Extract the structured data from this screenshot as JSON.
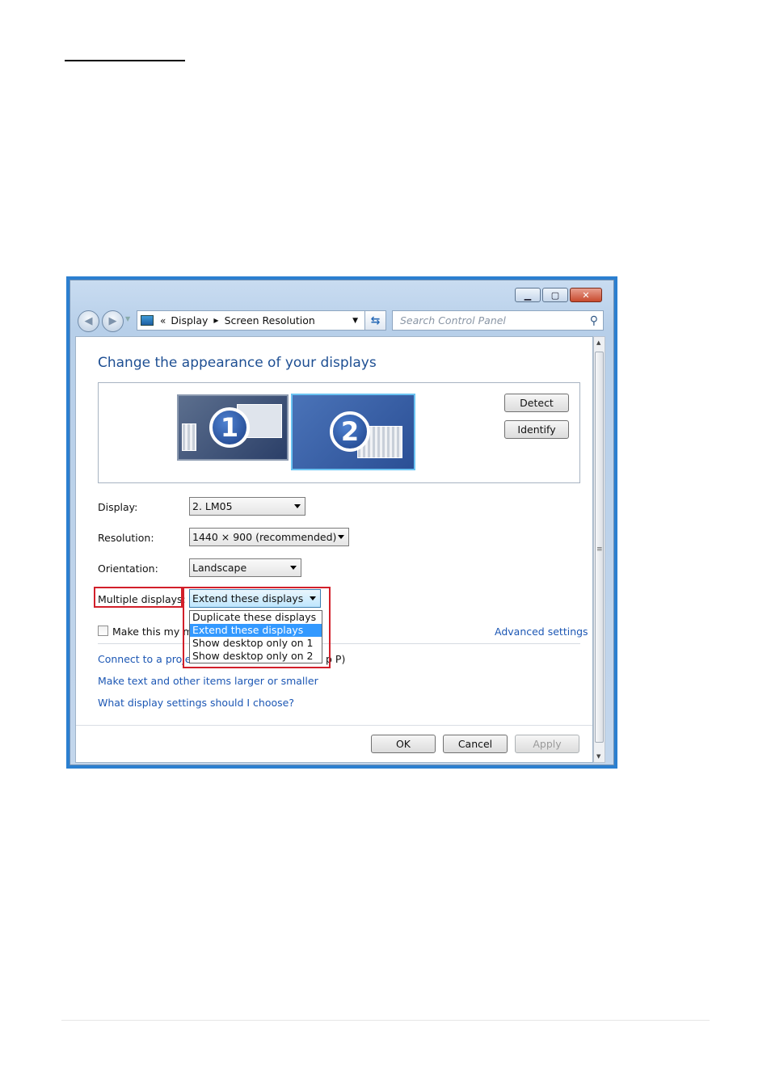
{
  "address_bar": {
    "chevrons": "«",
    "crumb_1": "Display",
    "crumb_2": "Screen Resolution"
  },
  "search": {
    "placeholder": "Search Control Panel"
  },
  "heading": "Change the appearance of your displays",
  "monitors": [
    {
      "number": "1"
    },
    {
      "number": "2"
    }
  ],
  "buttons": {
    "detect": "Detect",
    "identify": "Identify",
    "ok": "OK",
    "cancel": "Cancel",
    "apply": "Apply"
  },
  "fields": {
    "display_label": "Display:",
    "display_value": "2. LM05",
    "resolution_label": "Resolution:",
    "resolution_value": "1440 × 900 (recommended)",
    "orientation_label": "Orientation:",
    "orientation_value": "Landscape",
    "multiple_label": "Multiple displays:",
    "multiple_value": "Extend these displays"
  },
  "multiple_options": [
    "Duplicate these displays",
    "Extend these displays",
    "Show desktop only on 1",
    "Show desktop only on 2"
  ],
  "selected_option_index": 1,
  "checkbox": {
    "label_visible": "Make this my ma",
    "checked": false
  },
  "links": {
    "advanced": "Advanced settings",
    "connect_prefix": "Connect to a proje",
    "connect_suffix": "p P)",
    "text_size": "Make text and other items larger or smaller",
    "which_settings": "What display settings should I choose?"
  },
  "colors": {
    "link": "#1c57b4",
    "heading": "#1e4f93",
    "highlight_box": "#d21f2a",
    "selection": "#3399ff",
    "window_border": "#2b7fd0"
  },
  "icons": {
    "back": "back-arrow-icon",
    "forward": "forward-arrow-icon",
    "control_panel": "control-panel-icon",
    "refresh": "refresh-icon",
    "search": "magnifier-icon",
    "minimize": "minimize-icon",
    "maximize": "maximize-icon",
    "close": "close-icon"
  }
}
